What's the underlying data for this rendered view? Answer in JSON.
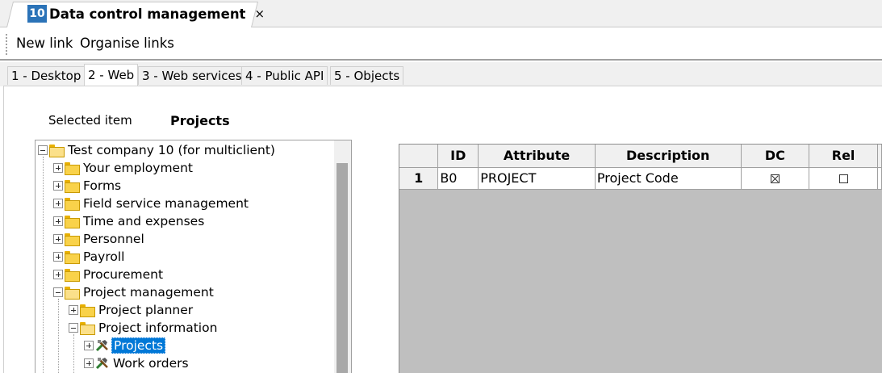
{
  "doc_tab": {
    "badge": "10",
    "title": "Data control management",
    "close": "×"
  },
  "toolbar": {
    "new_link": "New link",
    "organise_links": "Organise links"
  },
  "sub_tabs": [
    "1 - Desktop",
    "2 - Web",
    "3 - Web services",
    "4 - Public API",
    "5 - Objects"
  ],
  "active_sub_tab": "2 - Web",
  "selected_item": {
    "label": "Selected item",
    "value": "Projects"
  },
  "tree": {
    "root": "Test company 10 (for multiclient)",
    "items": [
      "Your employment",
      "Forms",
      "Field service management",
      "Time and expenses",
      "Personnel",
      "Payroll",
      "Procurement",
      "Project management",
      "Project planner",
      "Project information",
      "Projects",
      "Work orders"
    ]
  },
  "grid": {
    "headers": {
      "rownum": "",
      "id": "ID",
      "attribute": "Attribute",
      "description": "Description",
      "dc": "DC",
      "rel": "Rel"
    },
    "rows": [
      {
        "rownum": "1",
        "id": "B0",
        "attribute": "PROJECT",
        "description": "Project Code",
        "dc": true,
        "rel": false
      }
    ]
  },
  "colors": {
    "accent": "#0078d7",
    "badge": "#2b73b8",
    "folder": "#f9d24a",
    "grid_empty": "#bfbfbf"
  }
}
